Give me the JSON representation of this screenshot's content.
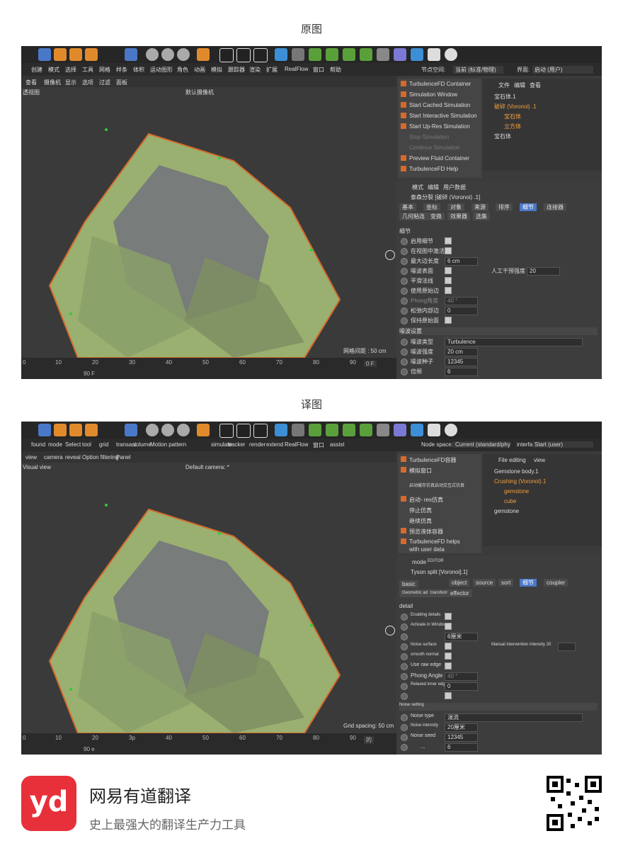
{
  "captions": {
    "original": "原图",
    "translated": "译图"
  },
  "original": {
    "menu": [
      "创建",
      "模式",
      "选择",
      "工具",
      "网格",
      "样条",
      "体积",
      "运动图形",
      "角色",
      "动画",
      "模拟",
      "跟踪器",
      "渲染",
      "扩展",
      "RealFlow",
      "窗口",
      "帮助"
    ],
    "node_space_label": "节点空间:",
    "node_space_value": "当前 (标准/物理)",
    "interface_label": "界面:",
    "interface_value": "启动 (用户)",
    "view_menu": [
      "查看",
      "摄像机",
      "显示",
      "选项",
      "过滤",
      "面板"
    ],
    "view_title": "透视图",
    "camera_label": "默认摄像机",
    "grid_text": "网格间距 : 50 cm",
    "sim_menu": [
      "TurbulenceFD Container",
      "Simulation Window",
      "Start Cached Simulation",
      "Start Interactive Simulation",
      "Start Up-Res Simulation",
      "Stop Simulation",
      "Continue Simulation",
      "Preview Fluid Container",
      "TurbulenceFD Help"
    ],
    "om_menu": [
      "文件",
      "编辑",
      "查看"
    ],
    "objects": [
      "宝石体.1",
      "破碎 (Voronoi) .1",
      "宝石体",
      "立方体",
      "宝石体"
    ],
    "attr_menu": [
      "模式",
      "编辑",
      "用户数据"
    ],
    "attr_title": "泰森分裂 [破碎 (Voronoi) .1]",
    "tabs1": [
      "基本",
      "坐标",
      "对象",
      "来源",
      "排序",
      "细节",
      "连接器"
    ],
    "tabs2": [
      "几何粘连",
      "变换",
      "效果器",
      "选集"
    ],
    "section": "细节",
    "rows": [
      "启用细节",
      "在视图中激活",
      "最大边长度",
      "噪波表面",
      "平滑法线",
      "使用原始边",
      "Phong角度",
      "松弛内部边",
      "保持原始面"
    ],
    "max_edge_value": "6 cm",
    "phong_value": "40 °",
    "relax_value": "0",
    "manual_label": "人工干预强度",
    "manual_value": "20",
    "noise_section": "噪波设置",
    "noise_rows": [
      "噪波类型",
      "噪波强度",
      "噪波种子",
      "倍频"
    ],
    "noise_type": "Turbulence",
    "noise_strength": "20 cm",
    "noise_seed": "12345",
    "octaves": "6",
    "ruler": [
      "0",
      "10",
      "20",
      "30",
      "40",
      "50",
      "60",
      "70",
      "80",
      "90"
    ],
    "frame": "0 F",
    "frame_end": "90 F"
  },
  "translated": {
    "menu": [
      "found",
      "mode",
      "Select",
      "tool",
      "grid",
      "transact",
      "volume",
      "Motion pattern",
      "simulate",
      "tracker",
      "render",
      "extend",
      "RealFlow",
      "窗口",
      "assist"
    ],
    "node_space_label": "Node space:",
    "node_space_value": "Current (standard/physics)",
    "interface_label": "interface",
    "interface_value": "Start (user)",
    "view_menu": [
      "view",
      "camera",
      "reveal",
      "Option filtering",
      "Panel"
    ],
    "view_title": "Visual view",
    "camera_label": "Default camera: *",
    "grid_text": "Grid spacing: 50 cm",
    "sim_menu": [
      "TurbulenceFD容器",
      "模拟窗口",
      "启动缓存仿真启动交互式仿真",
      "启动- res仿真",
      "停止仿真",
      "继续仿真",
      "预览液体容器",
      "TurbulenceFD helps",
      "with user data"
    ],
    "om_menu": [
      "File editing",
      "view"
    ],
    "objects": [
      "Gemstone body.1",
      "Crushing (Voronoi).1",
      "gemstone",
      "cube",
      "gemstone"
    ],
    "attr_menu": [
      "mode",
      "EDITOR"
    ],
    "attr_title": "Tyson split [Voronoi].1]",
    "tabs1": [
      "basic",
      "object",
      "source",
      "sort",
      "细节",
      "coupler"
    ],
    "tabs2": [
      "Geometric adhesion",
      "transform",
      "effector"
    ],
    "section": "detail",
    "rows": [
      "Enabling details",
      "Activate in Windows",
      "",
      "Noise surface",
      "smooth normal",
      "Use raw edge",
      "Phong Angle",
      "Relaxed inner edge",
      ""
    ],
    "max_edge_value": "6厘米",
    "phong_value": "40 °",
    "relax_value": "0",
    "manual_label": "Manual intervention intensity 20",
    "manual_value": "",
    "noise_section": "Noise setting",
    "noise_rows": [
      "Noise type",
      "Noise intensity",
      "Noise seed",
      "..."
    ],
    "noise_type": "湍流",
    "noise_strength": "20厘米",
    "noise_seed": "12345",
    "octaves": "6",
    "ruler": [
      "0",
      "10",
      "20",
      "3p",
      "40",
      "50",
      "60",
      "70",
      "80",
      "90"
    ],
    "frame": "的",
    "frame_end": "90 e"
  },
  "footer": {
    "brand_logo": "yd",
    "app_name": "网易有道翻译",
    "slogan": "史上最强大的翻译生产力工具"
  },
  "colors": {
    "accent": "#4a78c8",
    "brand": "#e8303a",
    "gem": "#9ab070",
    "orange": "#d56a2c"
  }
}
